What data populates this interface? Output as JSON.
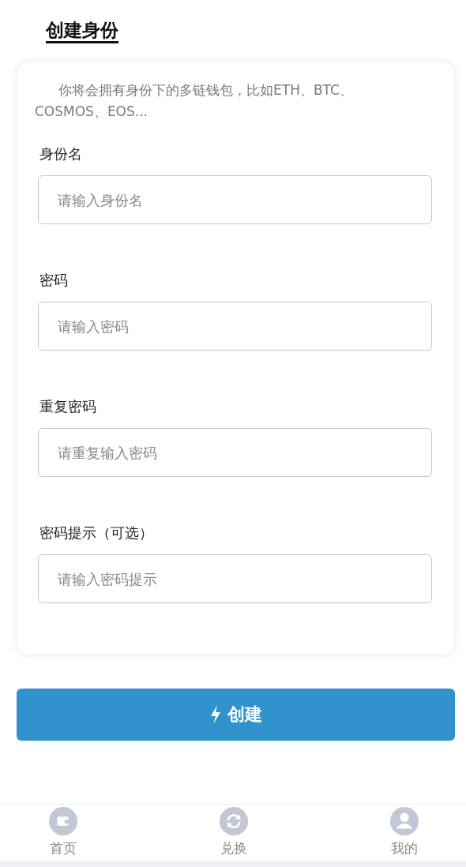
{
  "page_title": "创建身份",
  "intro": "你将会拥有身份下的多链钱包，比如ETH、BTC、COSMOS、EOS...",
  "fields": [
    {
      "label": "身份名",
      "placeholder": "请输入身份名"
    },
    {
      "label": "密码",
      "placeholder": "请输入密码"
    },
    {
      "label": "重复密码",
      "placeholder": "请重复输入密码"
    },
    {
      "label": "密码提示（可选）",
      "placeholder": "请输入密码提示"
    }
  ],
  "create_button": "创建",
  "nav": [
    {
      "label": "首页"
    },
    {
      "label": "兑换"
    },
    {
      "label": "我的"
    }
  ]
}
